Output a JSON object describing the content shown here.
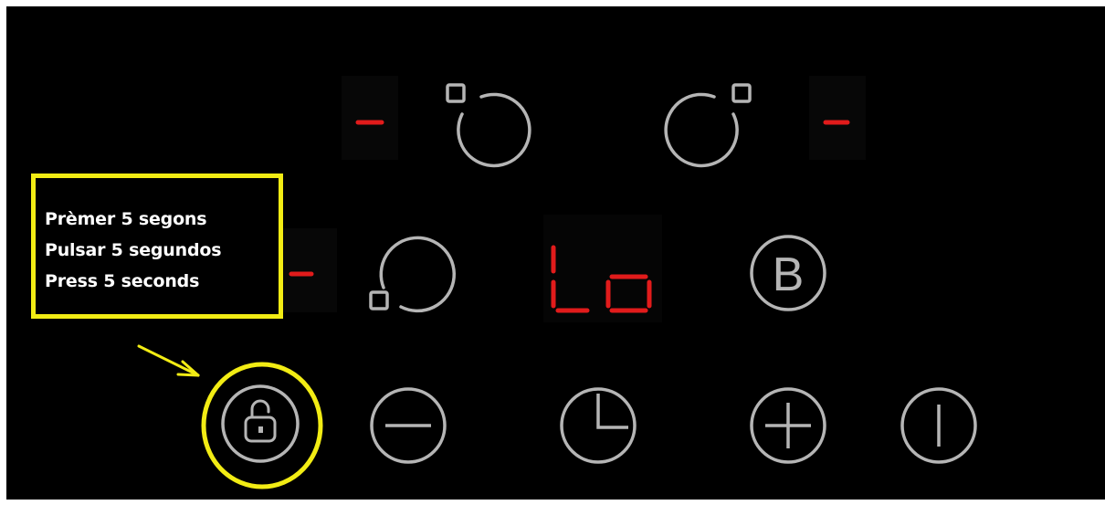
{
  "instruction": {
    "lines": [
      "Prèmer 5 segons",
      "Pulsar 5 segundos",
      "Press 5 seconds"
    ]
  },
  "display": {
    "center_code": "Lo",
    "zone_top_left": "-",
    "zone_top_right": "-",
    "zone_middle_left": "-"
  },
  "colors": {
    "panel_background": "#000000",
    "button_outline": "#b5b5b5",
    "segment_red": "#e11b1b",
    "highlight_yellow": "#f2ec14",
    "instruction_text": "#ffffff"
  },
  "controls": {
    "zone_top_left_selector": "zone-selector-icon",
    "zone_top_right_selector": "zone-selector-icon",
    "zone_bottom_left_selector": "zone-selector-icon",
    "booster": "B",
    "lock": "padlock-icon",
    "minus": "minus-icon",
    "timer": "clock-icon",
    "plus": "plus-icon",
    "power": "power-icon"
  }
}
